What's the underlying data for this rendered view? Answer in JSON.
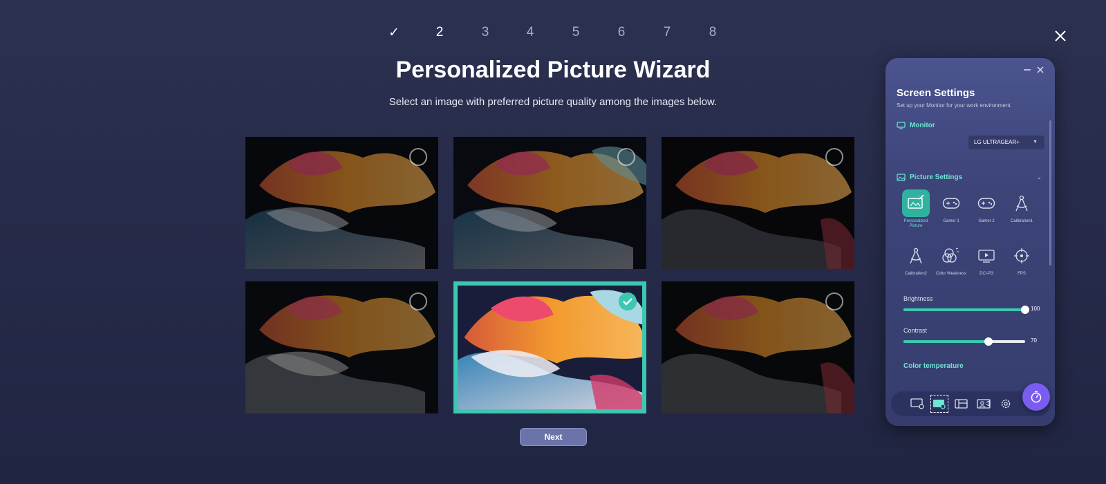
{
  "wizard": {
    "steps": [
      "✓",
      "2",
      "3",
      "4",
      "5",
      "6",
      "7",
      "8"
    ],
    "title": "Personalized Picture Wizard",
    "subtitle": "Select an image with preferred picture quality among the images below.",
    "next_label": "Next",
    "selected_index": 4
  },
  "panel": {
    "title": "Screen Settings",
    "subtitle": "Set up your Monitor for your work environment.",
    "monitor_label": "Monitor",
    "monitor_value": "LG ULTRAGEAR+",
    "picture_settings_label": "Picture Settings",
    "modes": [
      {
        "label": "Personalized Picture",
        "icon": "personalized-picture-icon"
      },
      {
        "label": "Gamer 1",
        "icon": "gamepad-icon"
      },
      {
        "label": "Gamer 2",
        "icon": "gamepad-icon"
      },
      {
        "label": "Calibration1",
        "icon": "compass-icon"
      },
      {
        "label": "Calibration2",
        "icon": "compass-icon"
      },
      {
        "label": "Color Weakness",
        "icon": "color-weakness-icon"
      },
      {
        "label": "DCI-P3",
        "icon": "dci-icon"
      },
      {
        "label": "FPS",
        "icon": "crosshair-icon"
      }
    ],
    "brightness_label": "Brightness",
    "brightness_value": "100",
    "contrast_label": "Contrast",
    "contrast_value": "70",
    "color_temp_label": "Color temperature"
  },
  "colors": {
    "accent": "#3cc7b0",
    "fab": "#7a5cf0",
    "background": "#262b49"
  }
}
